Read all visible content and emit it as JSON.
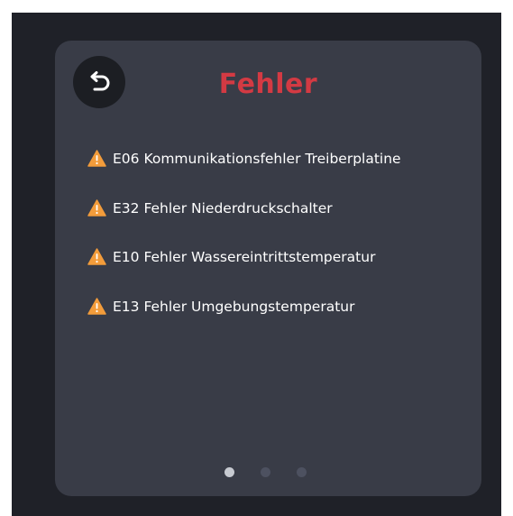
{
  "screen": {
    "title": "Fehler",
    "back_icon": "undo-arrow-icon",
    "errors": [
      {
        "icon": "warning-triangle-icon",
        "text": "E06 Kommunikationsfehler Treiberplatine"
      },
      {
        "icon": "warning-triangle-icon",
        "text": "E32 Fehler Niederdruckschalter"
      },
      {
        "icon": "warning-triangle-icon",
        "text": "E10 Fehler Wassereintrittstemperatur"
      },
      {
        "icon": "warning-triangle-icon",
        "text": "E13 Fehler Umgebungstemperatur"
      }
    ],
    "pager": {
      "pages": 3,
      "active_page": 1
    }
  },
  "colors": {
    "title": "#d33a43",
    "warning": "#f39c3b",
    "panel": "#393c47",
    "frame": "#1f2128"
  }
}
